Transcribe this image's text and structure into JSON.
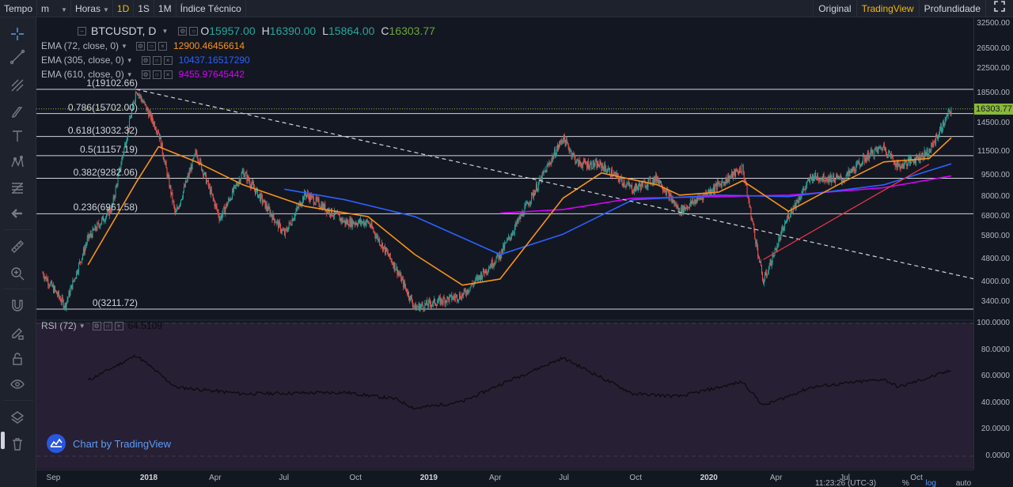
{
  "topbar": {
    "items": [
      {
        "label": "Tempo",
        "active": false
      },
      {
        "label": "m",
        "caret": true,
        "active": false
      },
      {
        "label": "Horas",
        "caret": true,
        "active": false
      },
      {
        "label": "1D",
        "active": true
      },
      {
        "label": "1S",
        "active": false
      },
      {
        "label": "1M",
        "active": false
      },
      {
        "label": "Índice Técnico",
        "active": false
      }
    ],
    "right": [
      {
        "label": "Original",
        "active": false
      },
      {
        "label": "TradingView",
        "active": true
      },
      {
        "label": "Profundidade",
        "active": false
      }
    ]
  },
  "legend": {
    "symbol": "BTCUSDT, D",
    "o_label": "O",
    "o": "15957.00",
    "h_label": "H",
    "h": "16390.00",
    "l_label": "L",
    "l": "15864.00",
    "c_label": "C",
    "c": "16303.77",
    "ema": [
      {
        "name": "EMA (72, close, 0)",
        "value": "12900.46456614",
        "color": "#f7931a"
      },
      {
        "name": "EMA (305, close, 0)",
        "value": "10437.16517290",
        "color": "#2962ff"
      },
      {
        "name": "EMA (610, close, 0)",
        "value": "9455.97645442",
        "color": "#d500f9"
      }
    ],
    "rsi": {
      "name": "RSI (72)",
      "value": "64.5109"
    }
  },
  "fib_levels": [
    {
      "label": "1(19102.66)",
      "price": 19102.66
    },
    {
      "label": "0.786(15702.00)",
      "price": 15702.0
    },
    {
      "label": "0.618(13032.32)",
      "price": 13032.32
    },
    {
      "label": "0.5(11157.19)",
      "price": 11157.19
    },
    {
      "label": "0.382(9282.06)",
      "price": 9282.06
    },
    {
      "label": "0.236(6961.58)",
      "price": 6961.58
    },
    {
      "label": "0(3211.72)",
      "price": 3211.72
    }
  ],
  "price_axis": [
    "32500.00",
    "26500.00",
    "22500.00",
    "18500.00",
    "14500.00",
    "11500.00",
    "9500.00",
    "8000.00",
    "6800.00",
    "5800.00",
    "4800.00",
    "4000.00",
    "3400.00"
  ],
  "last_price": "16303.77",
  "rsi_axis": [
    "100.0000",
    "80.0000",
    "60.0000",
    "40.0000",
    "20.0000",
    "0.0000"
  ],
  "time_axis": [
    {
      "label": "Sep",
      "bold": false
    },
    {
      "label": "2018",
      "bold": true
    },
    {
      "label": "Apr",
      "bold": false
    },
    {
      "label": "Jul",
      "bold": false
    },
    {
      "label": "Oct",
      "bold": false
    },
    {
      "label": "2019",
      "bold": true
    },
    {
      "label": "Apr",
      "bold": false
    },
    {
      "label": "Jul",
      "bold": false
    },
    {
      "label": "Oct",
      "bold": false
    },
    {
      "label": "2020",
      "bold": true
    },
    {
      "label": "Apr",
      "bold": false
    },
    {
      "label": "Jul",
      "bold": false
    },
    {
      "label": "Oct",
      "bold": false
    }
  ],
  "bottom": {
    "clock": "11:23:26 (UTC-3)",
    "pct": "%",
    "log": "log",
    "auto": "auto"
  },
  "watermark": "Chart by TradingView",
  "colors": {
    "up": "#26a69a",
    "down": "#ef5350",
    "bg": "#131722",
    "accent": "#f0b90b",
    "rsi": "#0b0b0e"
  },
  "icons": [
    "crosshair-icon",
    "trend-line-icon",
    "pitchfork-icon",
    "brush-icon",
    "text-icon",
    "pattern-icon",
    "fib-icon",
    "back-arrow-icon",
    "ruler-icon",
    "zoom-icon",
    "magnet-icon",
    "pencil-lock-icon",
    "lock-icon",
    "eye-icon",
    "layers-icon",
    "trash-icon"
  ],
  "chart_data": {
    "type": "candlestick",
    "x_range": [
      "2017-08",
      "2020-11"
    ],
    "price_scale": "log",
    "close_series": [
      {
        "date": "2017-08-17",
        "close": 4300
      },
      {
        "date": "2017-09-15",
        "close": 3300
      },
      {
        "date": "2017-10-15",
        "close": 5700
      },
      {
        "date": "2017-11-15",
        "close": 7300
      },
      {
        "date": "2017-12-17",
        "close": 19100
      },
      {
        "date": "2018-01-15",
        "close": 13500
      },
      {
        "date": "2018-02-06",
        "close": 6900
      },
      {
        "date": "2018-03-05",
        "close": 11500
      },
      {
        "date": "2018-04-05",
        "close": 6700
      },
      {
        "date": "2018-05-05",
        "close": 9800
      },
      {
        "date": "2018-06-28",
        "close": 5900
      },
      {
        "date": "2018-07-25",
        "close": 8200
      },
      {
        "date": "2018-09-15",
        "close": 6500
      },
      {
        "date": "2018-10-15",
        "close": 6500
      },
      {
        "date": "2018-11-20",
        "close": 4500
      },
      {
        "date": "2018-12-15",
        "close": 3250
      },
      {
        "date": "2019-02-15",
        "close": 3600
      },
      {
        "date": "2019-04-05",
        "close": 5000
      },
      {
        "date": "2019-05-15",
        "close": 7900
      },
      {
        "date": "2019-06-26",
        "close": 12900
      },
      {
        "date": "2019-07-15",
        "close": 10500
      },
      {
        "date": "2019-08-15",
        "close": 10300
      },
      {
        "date": "2019-09-25",
        "close": 8500
      },
      {
        "date": "2019-10-27",
        "close": 9300
      },
      {
        "date": "2019-11-25",
        "close": 7100
      },
      {
        "date": "2020-01-15",
        "close": 8800
      },
      {
        "date": "2020-02-15",
        "close": 10100
      },
      {
        "date": "2020-03-13",
        "close": 4000
      },
      {
        "date": "2020-04-15",
        "close": 6900
      },
      {
        "date": "2020-05-15",
        "close": 9400
      },
      {
        "date": "2020-06-25",
        "close": 9200
      },
      {
        "date": "2020-07-28",
        "close": 11200
      },
      {
        "date": "2020-08-17",
        "close": 12000
      },
      {
        "date": "2020-09-05",
        "close": 10200
      },
      {
        "date": "2020-10-15",
        "close": 11500
      },
      {
        "date": "2020-11-13",
        "close": 16303.77
      }
    ],
    "ema72": [
      {
        "date": "2017-10-15",
        "value": 4600
      },
      {
        "date": "2017-12-17",
        "value": 9000
      },
      {
        "date": "2018-01-15",
        "value": 12000
      },
      {
        "date": "2018-03-05",
        "value": 10600
      },
      {
        "date": "2018-05-05",
        "value": 8800
      },
      {
        "date": "2018-07-25",
        "value": 7400
      },
      {
        "date": "2018-10-15",
        "value": 6800
      },
      {
        "date": "2018-12-15",
        "value": 5000
      },
      {
        "date": "2019-02-15",
        "value": 3900
      },
      {
        "date": "2019-04-05",
        "value": 4100
      },
      {
        "date": "2019-06-26",
        "value": 7900
      },
      {
        "date": "2019-08-15",
        "value": 9700
      },
      {
        "date": "2019-10-27",
        "value": 8800
      },
      {
        "date": "2019-11-25",
        "value": 8100
      },
      {
        "date": "2020-01-15",
        "value": 8300
      },
      {
        "date": "2020-02-15",
        "value": 9100
      },
      {
        "date": "2020-04-15",
        "value": 7100
      },
      {
        "date": "2020-06-25",
        "value": 9000
      },
      {
        "date": "2020-08-17",
        "value": 10600
      },
      {
        "date": "2020-10-15",
        "value": 10900
      },
      {
        "date": "2020-11-13",
        "value": 12900.46
      }
    ],
    "ema305": [
      {
        "date": "2018-06-28",
        "value": 8500
      },
      {
        "date": "2018-09-15",
        "value": 7800
      },
      {
        "date": "2018-12-15",
        "value": 6800
      },
      {
        "date": "2019-04-05",
        "value": 5000
      },
      {
        "date": "2019-06-26",
        "value": 5900
      },
      {
        "date": "2019-09-25",
        "value": 7800
      },
      {
        "date": "2020-01-15",
        "value": 8100
      },
      {
        "date": "2020-04-15",
        "value": 8000
      },
      {
        "date": "2020-08-17",
        "value": 8800
      },
      {
        "date": "2020-11-13",
        "value": 10437.17
      }
    ],
    "ema610": [
      {
        "date": "2019-04-05",
        "value": 7000
      },
      {
        "date": "2019-06-26",
        "value": 7200
      },
      {
        "date": "2019-09-25",
        "value": 7900
      },
      {
        "date": "2020-01-15",
        "value": 8000
      },
      {
        "date": "2020-04-15",
        "value": 8100
      },
      {
        "date": "2020-08-17",
        "value": 8600
      },
      {
        "date": "2020-11-13",
        "value": 9455.98
      }
    ],
    "rsi72": [
      {
        "date": "2017-10-15",
        "value": 57
      },
      {
        "date": "2017-12-17",
        "value": 76
      },
      {
        "date": "2018-02-06",
        "value": 52
      },
      {
        "date": "2018-05-05",
        "value": 47
      },
      {
        "date": "2018-09-15",
        "value": 48
      },
      {
        "date": "2018-11-20",
        "value": 43
      },
      {
        "date": "2018-12-15",
        "value": 36
      },
      {
        "date": "2019-02-15",
        "value": 41
      },
      {
        "date": "2019-04-05",
        "value": 54
      },
      {
        "date": "2019-06-26",
        "value": 74
      },
      {
        "date": "2019-09-25",
        "value": 47
      },
      {
        "date": "2019-11-25",
        "value": 45
      },
      {
        "date": "2020-02-15",
        "value": 56
      },
      {
        "date": "2020-03-13",
        "value": 38
      },
      {
        "date": "2020-05-15",
        "value": 52
      },
      {
        "date": "2020-08-17",
        "value": 58
      },
      {
        "date": "2020-09-05",
        "value": 52
      },
      {
        "date": "2020-11-13",
        "value": 64.51
      }
    ],
    "rsi_range": [
      0,
      100
    ],
    "trend_lines": [
      {
        "style": "dashed",
        "from": {
          "date": "2017-12-17",
          "price": 19100
        },
        "to": {
          "date": "2020-12-31",
          "price": 4000
        }
      },
      {
        "style": "solid",
        "color": "#f23645",
        "from": {
          "date": "2020-03-13",
          "price": 4800
        },
        "to": {
          "date": "2020-10-15",
          "price": 10400
        }
      }
    ]
  }
}
